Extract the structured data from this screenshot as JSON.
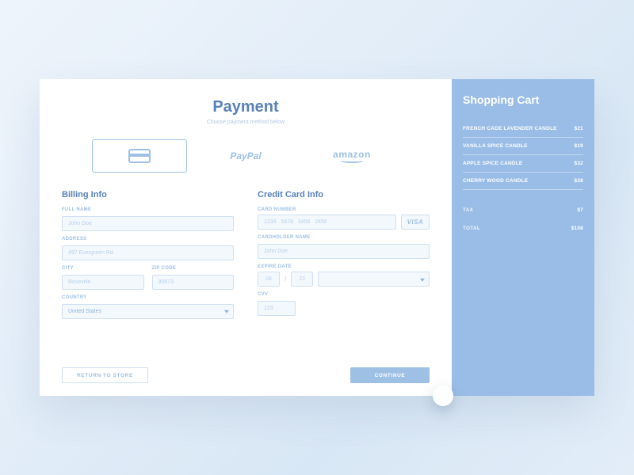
{
  "header": {
    "title": "Payment",
    "subtitle": "Choose payment method below"
  },
  "methods": {
    "paypal": "PayPal",
    "amazon": "amazon"
  },
  "billing": {
    "section": "Billing Info",
    "full_name_label": "FULL NAME",
    "full_name_ph": "John Doe",
    "address_label": "ADDRESS",
    "address_ph": "497 Evergreen Rd.",
    "city_label": "CITY",
    "city_ph": "Roseville",
    "zip_label": "ZIP CODE",
    "zip_ph": "95673",
    "country_label": "COUNTRY",
    "country_value": "United States"
  },
  "cc": {
    "section": "Credit Card Info",
    "number_label": "CARD NUMBER",
    "number_ph": "1234   5678   3456   2456",
    "brand": "VISA",
    "holder_label": "CARDHOLDER NAME",
    "holder_ph": "John Doe",
    "exp_label": "EXPIRE DATE",
    "exp_mm": "08",
    "exp_yy": "21",
    "cvv_label": "CVV",
    "cvv_ph": "123"
  },
  "actions": {
    "return": "RETURN TO STORE",
    "continue": "CONTINUE"
  },
  "cart": {
    "title": "Shopping Cart",
    "items": [
      {
        "name": "FRENCH CADE LAVENDER CANDLE",
        "price": "$21"
      },
      {
        "name": "VANILLA SPICE CANDLE",
        "price": "$19"
      },
      {
        "name": "APPLE SPICE CANDLE",
        "price": "$32"
      },
      {
        "name": "CHERRY WOOD CANDLE",
        "price": "$28"
      }
    ],
    "tax_label": "TAX",
    "tax": "$7",
    "total_label": "TOTAL",
    "total": "$108"
  }
}
